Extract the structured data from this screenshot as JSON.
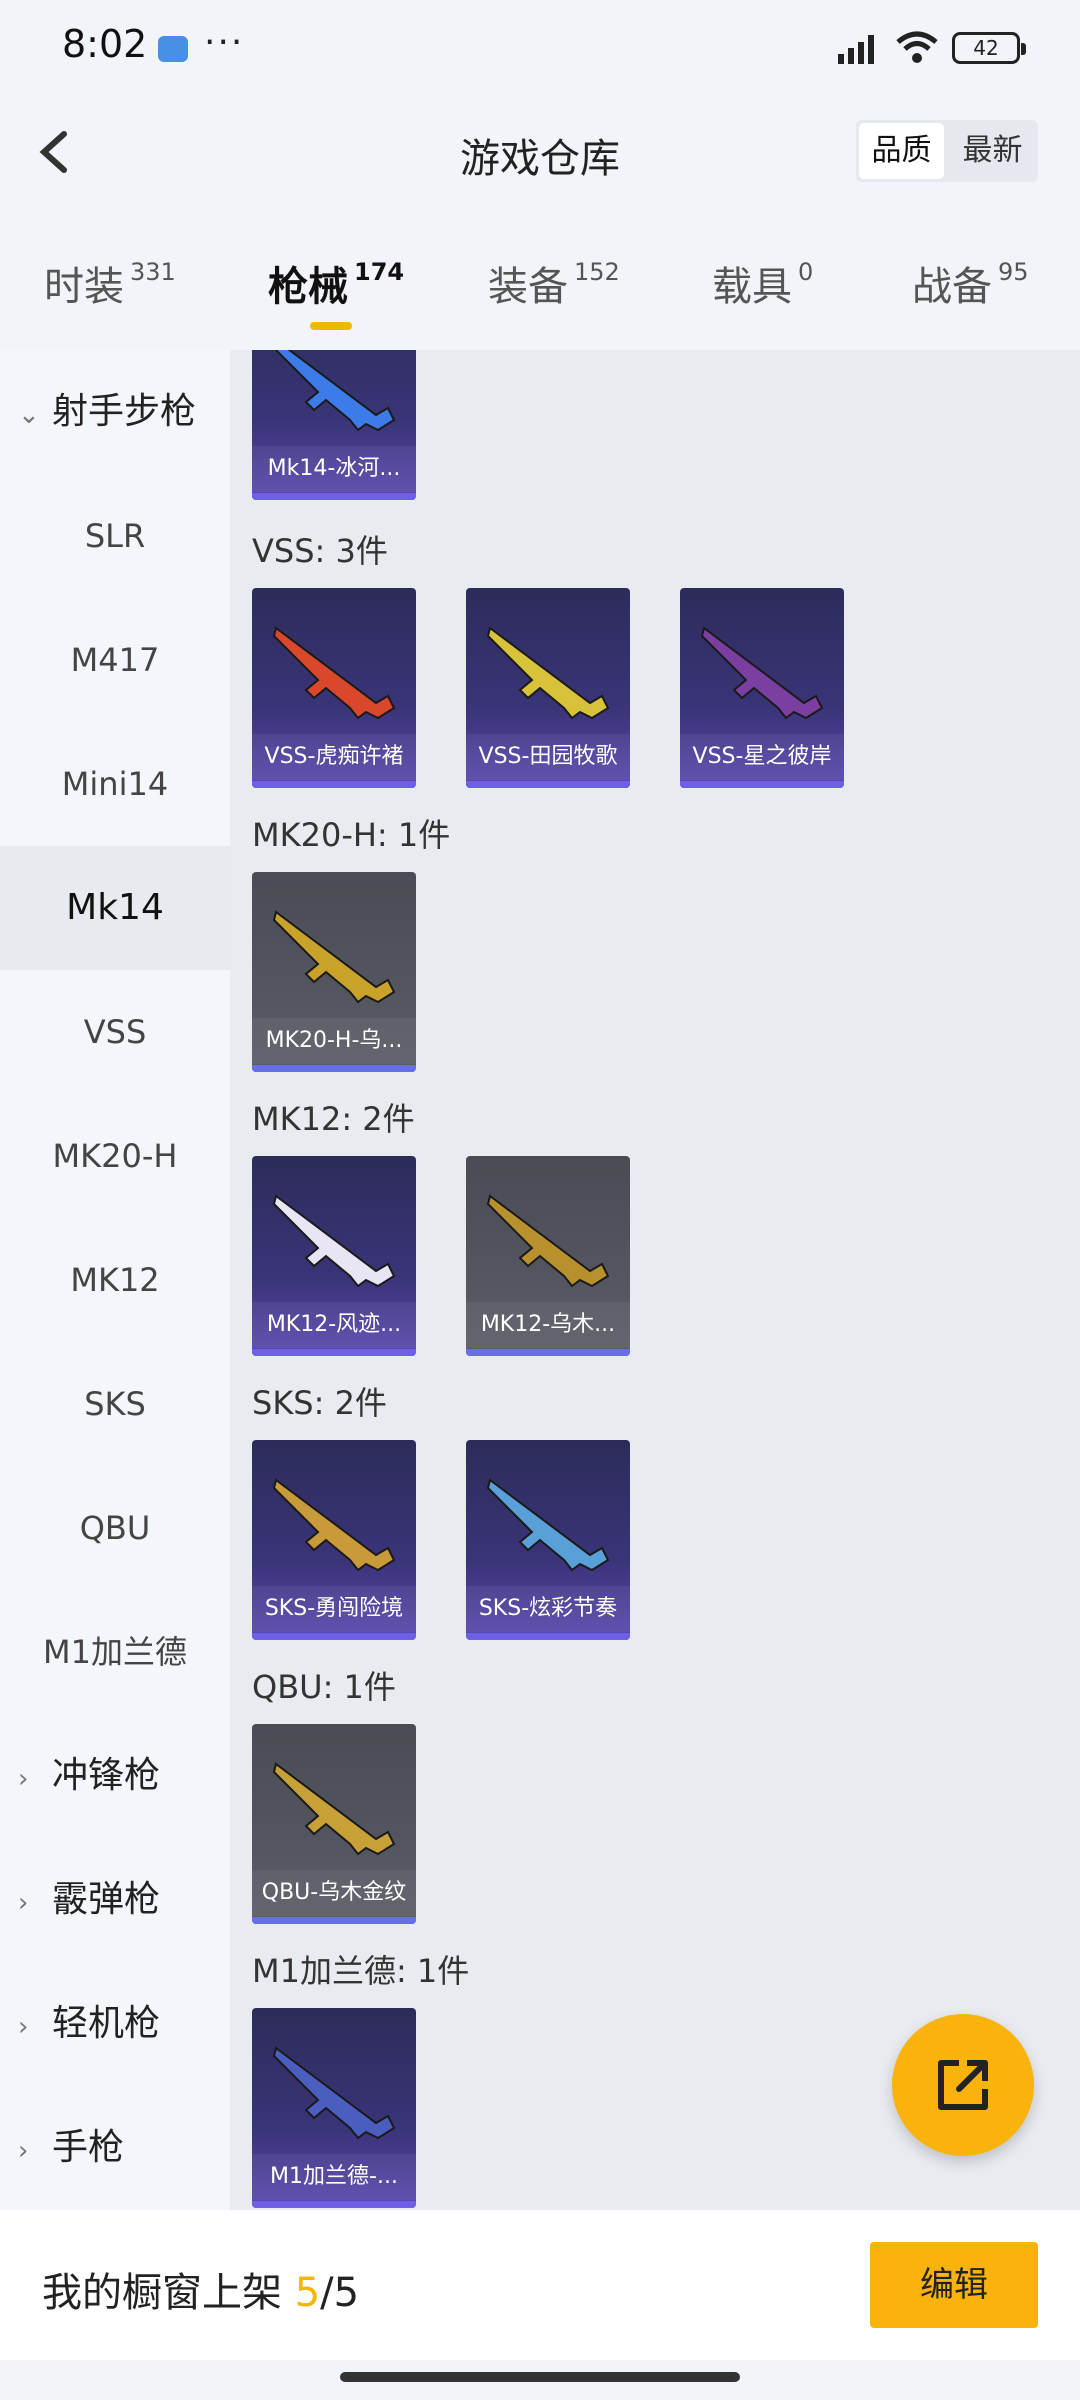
{
  "status_bar": {
    "time": "8:02",
    "more": "···",
    "battery": "42"
  },
  "header": {
    "title": "游戏仓库",
    "sort_quality": "品质",
    "sort_newest": "最新"
  },
  "tabs": [
    {
      "label": "时装",
      "count": "331"
    },
    {
      "label": "枪械",
      "count": "174"
    },
    {
      "label": "装备",
      "count": "152"
    },
    {
      "label": "载具",
      "count": "0"
    },
    {
      "label": "战备",
      "count": "95"
    }
  ],
  "sidebar": {
    "category_open": "射手步枪",
    "items": [
      "SLR",
      "M417",
      "Mini14",
      "Mk14",
      "VSS",
      "MK20-H",
      "MK12",
      "SKS",
      "QBU",
      "M1加兰德"
    ],
    "active": "Mk14",
    "categories_collapsed": [
      "冲锋枪",
      "霰弹枪",
      "轻机枪",
      "手枪"
    ]
  },
  "content": {
    "groups": [
      {
        "title": "",
        "cards": [
          {
            "name": "Mk14-冰河...",
            "style": "purple",
            "color": "#3c7be8"
          }
        ]
      },
      {
        "title": "VSS: 3件",
        "cards": [
          {
            "name": "VSS-虎痴许褚",
            "style": "purple",
            "color": "#d9482b"
          },
          {
            "name": "VSS-田园牧歌",
            "style": "purple",
            "color": "#d8c23a"
          },
          {
            "name": "VSS-星之彼岸",
            "style": "purple",
            "color": "#7a3fa0"
          }
        ]
      },
      {
        "title": "MK20-H: 1件",
        "cards": [
          {
            "name": "MK20-H-乌...",
            "style": "gray",
            "color": "#c9a22a"
          }
        ]
      },
      {
        "title": "MK12: 2件",
        "cards": [
          {
            "name": "MK12-风迹...",
            "style": "purple",
            "color": "#e8e6f4"
          },
          {
            "name": "MK12-乌木...",
            "style": "gray",
            "color": "#b8912c"
          }
        ]
      },
      {
        "title": "SKS: 2件",
        "cards": [
          {
            "name": "SKS-勇闯险境",
            "style": "purple",
            "color": "#c99a3a"
          },
          {
            "name": "SKS-炫彩节奏",
            "style": "purple",
            "color": "#5aa0d8"
          }
        ]
      },
      {
        "title": "QBU: 1件",
        "cards": [
          {
            "name": "QBU-乌木金纹",
            "style": "gray",
            "color": "#c7a038"
          }
        ]
      },
      {
        "title": "M1加兰德: 1件",
        "cards": [
          {
            "name": "M1加兰德-...",
            "style": "purple",
            "color": "#4a5ec0"
          }
        ]
      }
    ]
  },
  "bottom": {
    "label": "我的橱窗上架 ",
    "shelved": "5",
    "total": "/5",
    "edit": "编辑"
  },
  "colors": {
    "accent": "#f9b30c",
    "card_purple": "#3a3478",
    "card_gray": "#5a5c66"
  }
}
